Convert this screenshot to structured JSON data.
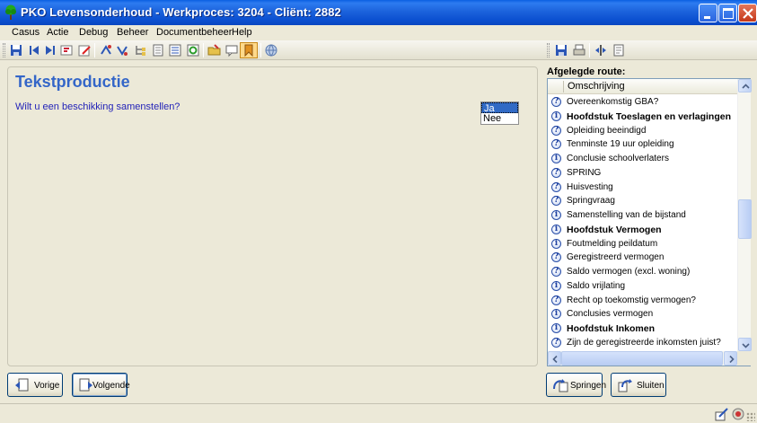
{
  "window": {
    "title": "PKO Levensonderhoud - Werkproces: 3204 - Cliënt: 2882",
    "buttons": [
      "minimize",
      "maximize",
      "close"
    ]
  },
  "menu": {
    "items": [
      "Casus",
      "Actie",
      "Debug",
      "Beheer",
      "Documentbeheer",
      "Help"
    ]
  },
  "toolbar": {
    "left_icons": [
      "save-icon",
      "first-icon",
      "last-icon",
      "return-icon",
      "edit-icon",
      "sort-up-icon",
      "sort-down-icon",
      "tree-icon",
      "document-icon",
      "list-icon",
      "refresh-icon",
      "open-folder-icon",
      "comment-icon",
      "bookmark-active-icon",
      "globe-icon"
    ],
    "right_icons": [
      "save-icon",
      "print-icon",
      "split-icon",
      "properties-icon"
    ]
  },
  "main": {
    "title": "Tekstproductie",
    "question": "Wilt u een beschikking samenstellen?",
    "answers": [
      "Ja",
      "Nee"
    ],
    "selected_answer": "Ja"
  },
  "route": {
    "label": "Afgelegde route:",
    "column_header": "Omschrijving",
    "rows": [
      {
        "icon": "question-icon",
        "text": "Overeenkomstig GBA?",
        "bold": false
      },
      {
        "icon": "info-icon",
        "text": "Hoofdstuk Toeslagen en verlagingen",
        "bold": true
      },
      {
        "icon": "question-icon",
        "text": "Opleiding beeindigd",
        "bold": false
      },
      {
        "icon": "question-icon",
        "text": "Tenminste 19 uur opleiding",
        "bold": false
      },
      {
        "icon": "info-icon",
        "text": "Conclusie schoolverlaters",
        "bold": false
      },
      {
        "icon": "question-icon",
        "text": "SPRING",
        "bold": false
      },
      {
        "icon": "question-icon",
        "text": "Huisvesting",
        "bold": false
      },
      {
        "icon": "question-icon",
        "text": "Springvraag",
        "bold": false
      },
      {
        "icon": "info-icon",
        "text": "Samenstelling van de bijstand",
        "bold": false
      },
      {
        "icon": "info-icon",
        "text": "Hoofdstuk Vermogen",
        "bold": true
      },
      {
        "icon": "info-icon",
        "text": "Foutmelding peildatum",
        "bold": false
      },
      {
        "icon": "question-icon",
        "text": "Geregistreerd vermogen",
        "bold": false
      },
      {
        "icon": "question-icon",
        "text": "Saldo vermogen (excl. woning)",
        "bold": false
      },
      {
        "icon": "info-icon",
        "text": "Saldo vrijlating",
        "bold": false
      },
      {
        "icon": "question-icon",
        "text": "Recht op toekomstig vermogen?",
        "bold": false
      },
      {
        "icon": "info-icon",
        "text": "Conclusies vermogen",
        "bold": false
      },
      {
        "icon": "info-icon",
        "text": "Hoofdstuk Inkomen",
        "bold": true
      },
      {
        "icon": "question-icon",
        "text": "Zijn de geregistreerde inkomsten juist?",
        "bold": false
      }
    ]
  },
  "buttons": {
    "prev": "Vorige",
    "next": "Volgende",
    "jump": "Springen",
    "close": "Sluiten"
  },
  "colors": {
    "title_accent": "#3466c8",
    "question_text": "#2323b8",
    "selection": "#316ac5",
    "titlebar": "#0a5fe2"
  }
}
